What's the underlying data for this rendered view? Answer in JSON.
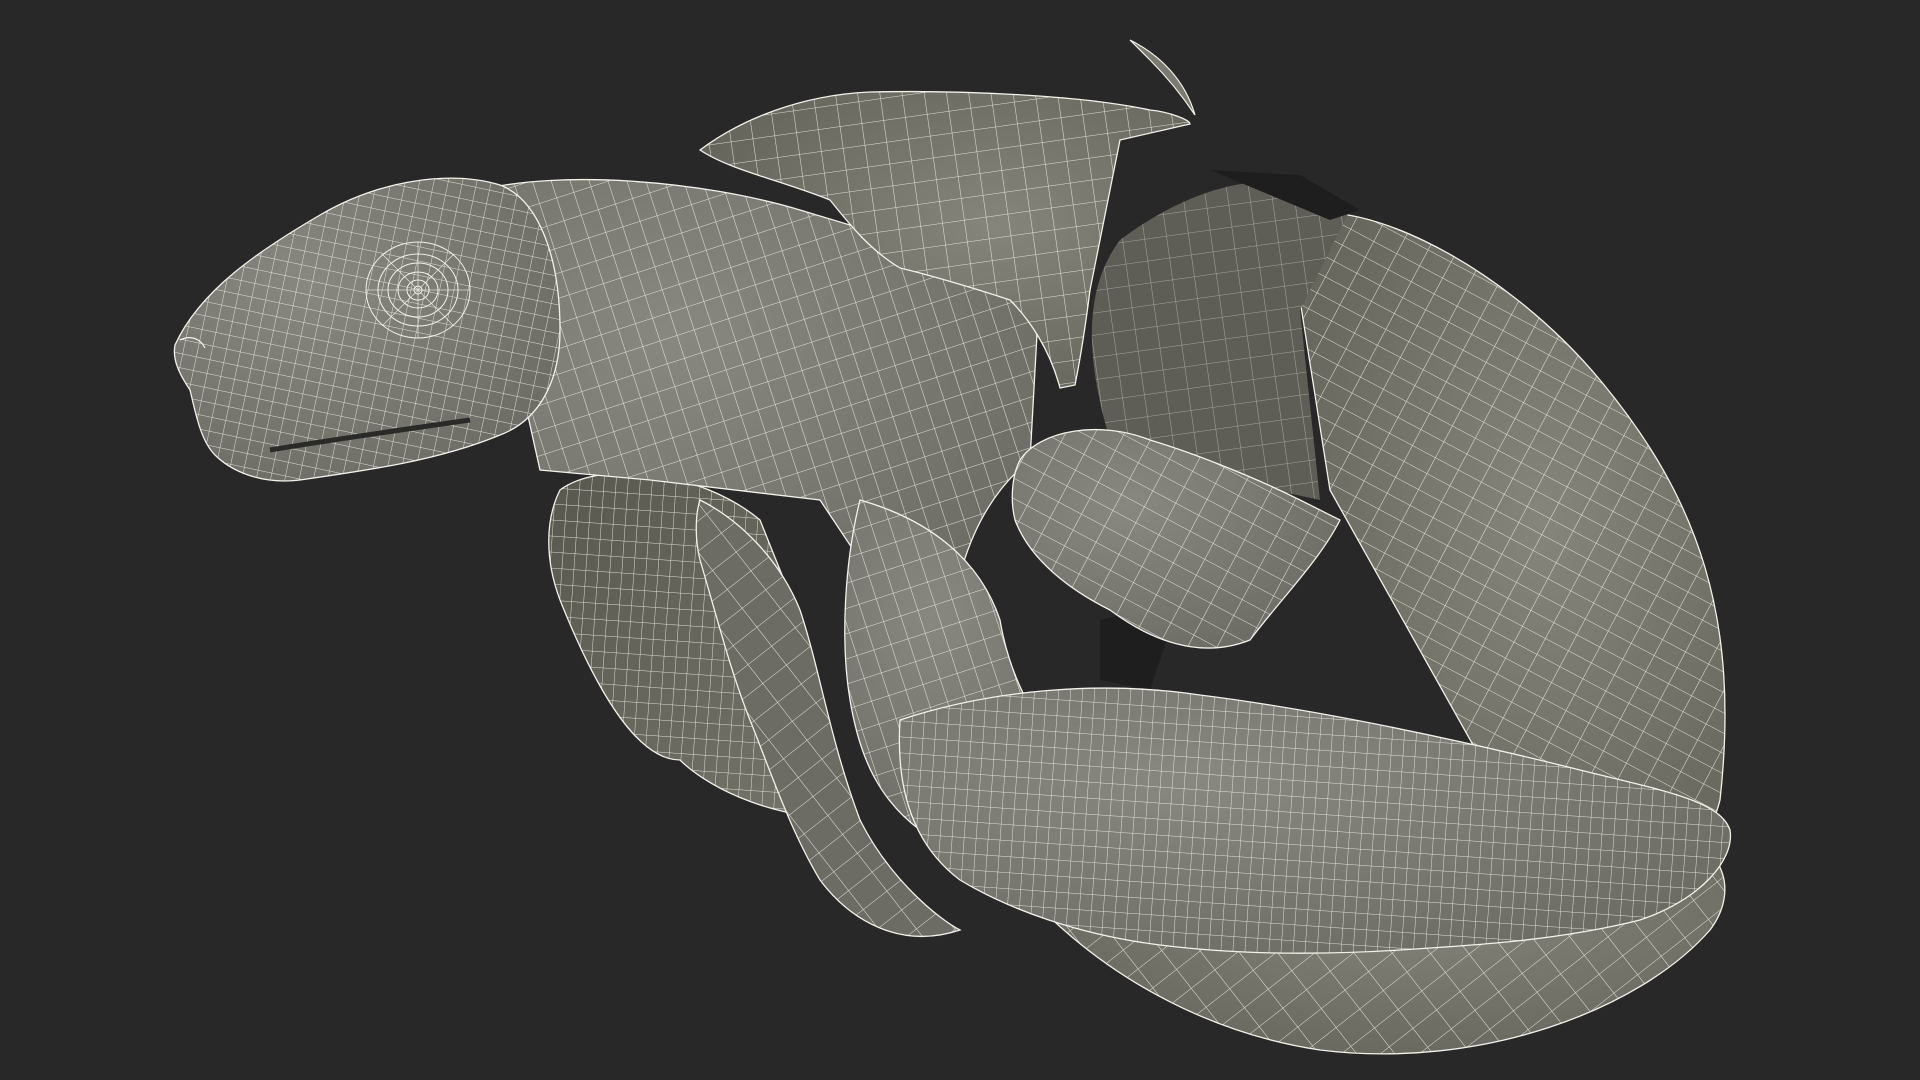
{
  "scene": {
    "subject_icon": "turtle-hatchling-wireframe-icon",
    "colors": {
      "background": "#282828",
      "mesh_fill": "#7a7a70",
      "mesh_fill_light": "#8a8a80",
      "mesh_fill_dark": "#5c5c54",
      "mesh_inner": "#6a6a62",
      "wireframe": "#f2f2ea",
      "hole": "#1e1e1e"
    }
  }
}
